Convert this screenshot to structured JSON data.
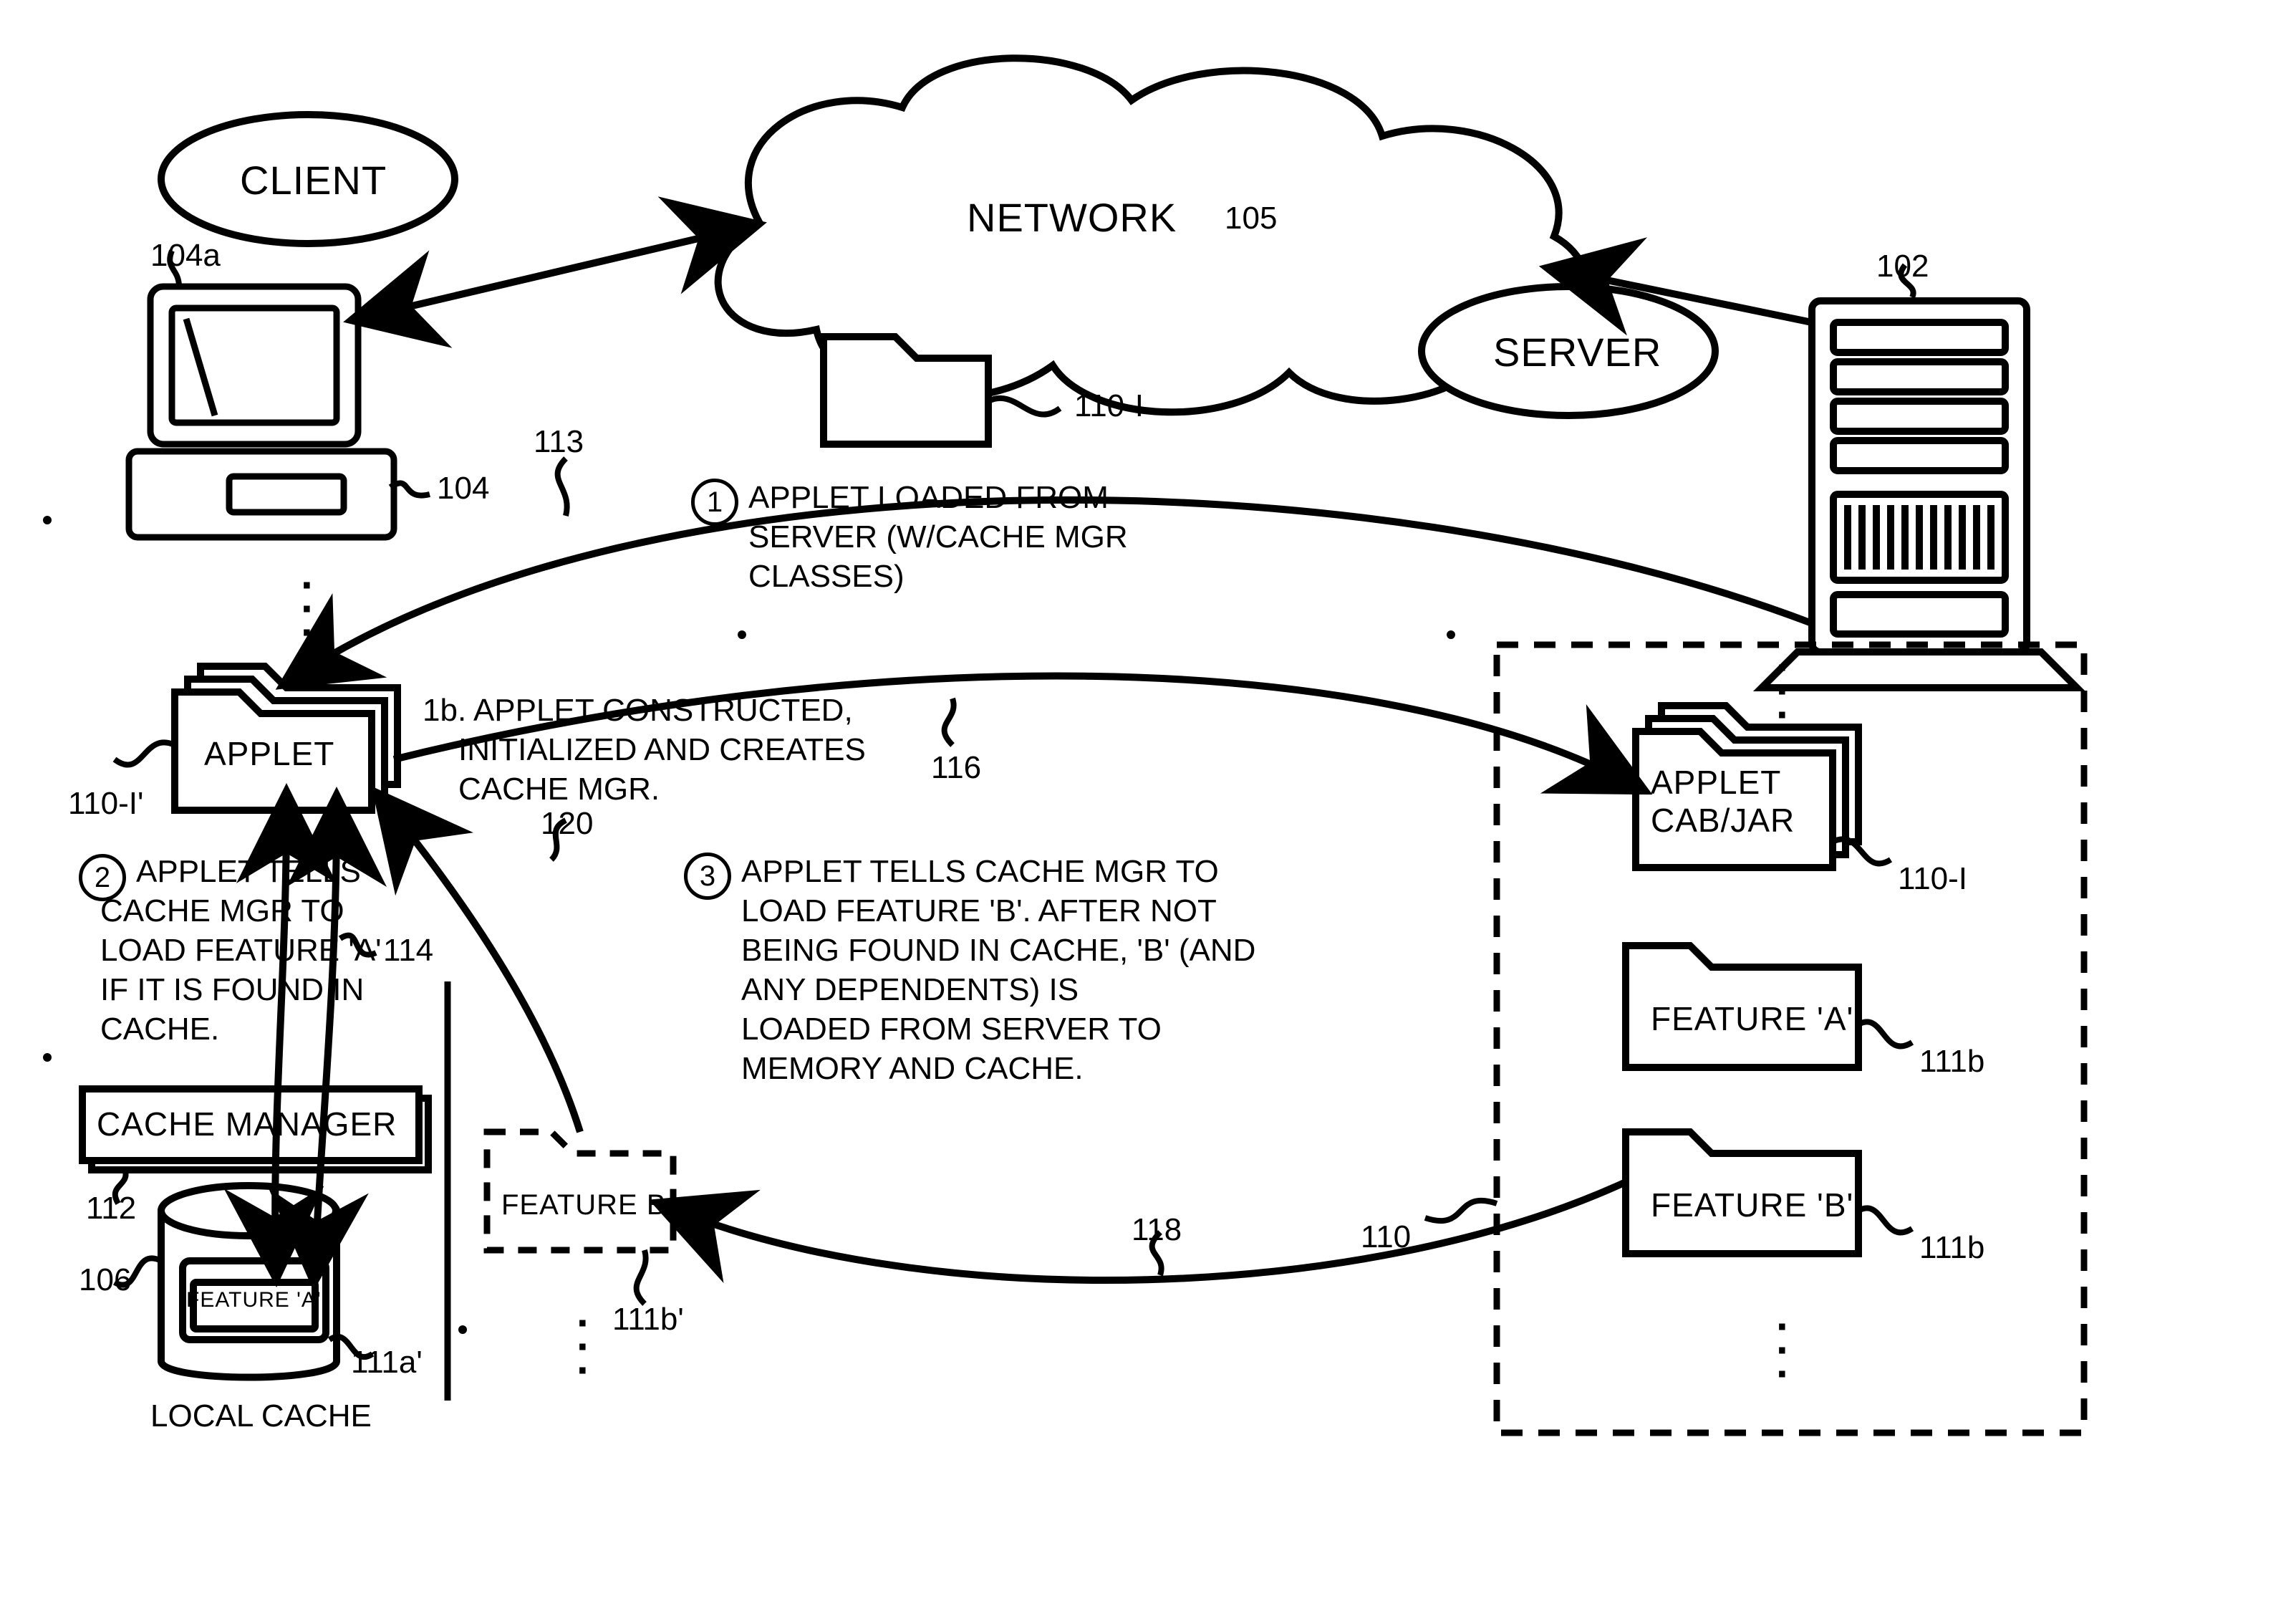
{
  "labels": {
    "client": "CLIENT",
    "server": "SERVER",
    "network": "NETWORK",
    "applet": "APPLET",
    "applet_cabjar_line1": "APPLET",
    "applet_cabjar_line2": "CAB/JAR",
    "feature_a": "FEATURE 'A'",
    "feature_b": "FEATURE 'B'",
    "feature_a_small": "FEATURE 'A'",
    "feature_b_box": "FEATURE B",
    "cache_manager": "CACHE MANAGER",
    "local_cache": "LOCAL CACHE"
  },
  "refs": {
    "r102": "102",
    "r104": "104",
    "r104a": "104a",
    "r105": "105",
    "r106": "106",
    "r110": "110",
    "r110_I": "110-I",
    "r110_I2": "110-I",
    "r110_Ip": "110-I'",
    "r111a_p": "111a'",
    "r111b": "111b",
    "r111b_2": "111b",
    "r111b_p": "111b'",
    "r112": "112",
    "r113": "113",
    "r114": "114",
    "r116": "116",
    "r118": "118",
    "r120": "120"
  },
  "steps": {
    "s1_l1": "APPLET LOADED FROM",
    "s1_l2": "SERVER (W/CACHE MGR",
    "s1_l3": "CLASSES)",
    "s1b_l1": "1b. APPLET CONSTRUCTED,",
    "s1b_l2": "INITIALIZED AND CREATES",
    "s1b_l3": "CACHE MGR.",
    "s2_l1": "APPLET TELLS",
    "s2_l2": "CACHE MGR TO",
    "s2_l3": "LOAD FEATURE 'A'",
    "s2_l4": "IF IT IS FOUND IN",
    "s2_l5": "CACHE.",
    "s3_l1": "APPLET TELLS CACHE MGR TO",
    "s3_l2": "LOAD FEATURE 'B'. AFTER NOT",
    "s3_l3": "BEING FOUND IN CACHE, 'B' (AND",
    "s3_l4": "ANY DEPENDENTS) IS",
    "s3_l5": "LOADED FROM SERVER TO",
    "s3_l6": "MEMORY AND CACHE."
  },
  "nums": {
    "n1": "1",
    "n2": "2",
    "n3": "3"
  }
}
